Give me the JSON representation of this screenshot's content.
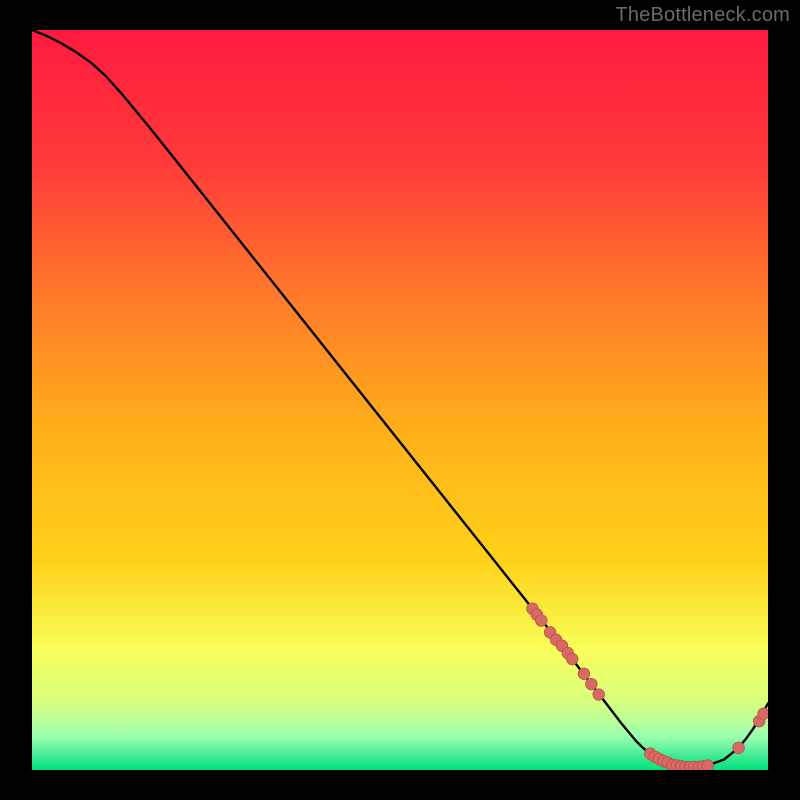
{
  "watermark": "TheBottleneck.com",
  "colors": {
    "background": "#000000",
    "gradient_top": "#ff1a3f",
    "gradient_mid1": "#ff7a2a",
    "gradient_mid2": "#ffd21a",
    "gradient_low1": "#f7ff5a",
    "gradient_low2": "#d6ff80",
    "gradient_bottom": "#00e47a",
    "curve": "#000000",
    "marker_fill": "#d86a63",
    "marker_stroke": "#b6524d"
  },
  "chart_data": {
    "type": "line",
    "title": "",
    "xlabel": "",
    "ylabel": "",
    "xlim": [
      0,
      100
    ],
    "ylim": [
      0,
      100
    ],
    "x": [
      0,
      2,
      4,
      6,
      8,
      10,
      12,
      16,
      20,
      24,
      28,
      32,
      36,
      40,
      44,
      48,
      52,
      56,
      60,
      64,
      68,
      72,
      76,
      78,
      80,
      82,
      83,
      84,
      85,
      86,
      87,
      88,
      89,
      90,
      91,
      92,
      94,
      96,
      97,
      98,
      99,
      100
    ],
    "y": [
      100,
      99.2,
      98.2,
      97.0,
      95.6,
      93.8,
      91.6,
      86.8,
      81.8,
      76.8,
      71.8,
      66.8,
      61.8,
      56.8,
      51.8,
      46.8,
      41.8,
      36.8,
      31.8,
      26.8,
      21.8,
      16.8,
      11.6,
      9.0,
      6.4,
      4.0,
      3.0,
      2.2,
      1.5,
      1.0,
      0.7,
      0.5,
      0.4,
      0.4,
      0.5,
      0.7,
      1.4,
      3.0,
      4.2,
      5.6,
      7.2,
      9.0
    ],
    "series": [
      {
        "name": "markers-on-curve",
        "type": "scatter",
        "x": [
          68,
          68.6,
          69.2,
          70.4,
          71.2,
          72.0,
          72.8,
          73.4,
          75.0,
          76.0,
          77.0,
          84.0,
          84.6,
          85.2,
          85.8,
          86.4,
          87.0,
          87.6,
          88.2,
          88.8,
          89.4,
          90.0,
          90.6,
          91.2,
          91.8,
          96.0,
          98.8,
          99.4
        ],
        "y": [
          21.8,
          21.0,
          20.2,
          18.6,
          17.6,
          16.8,
          15.8,
          15.0,
          13.0,
          11.6,
          10.2,
          2.2,
          1.8,
          1.5,
          1.2,
          1.0,
          0.7,
          0.6,
          0.5,
          0.4,
          0.4,
          0.4,
          0.4,
          0.5,
          0.6,
          3.0,
          6.6,
          7.6
        ]
      }
    ]
  }
}
